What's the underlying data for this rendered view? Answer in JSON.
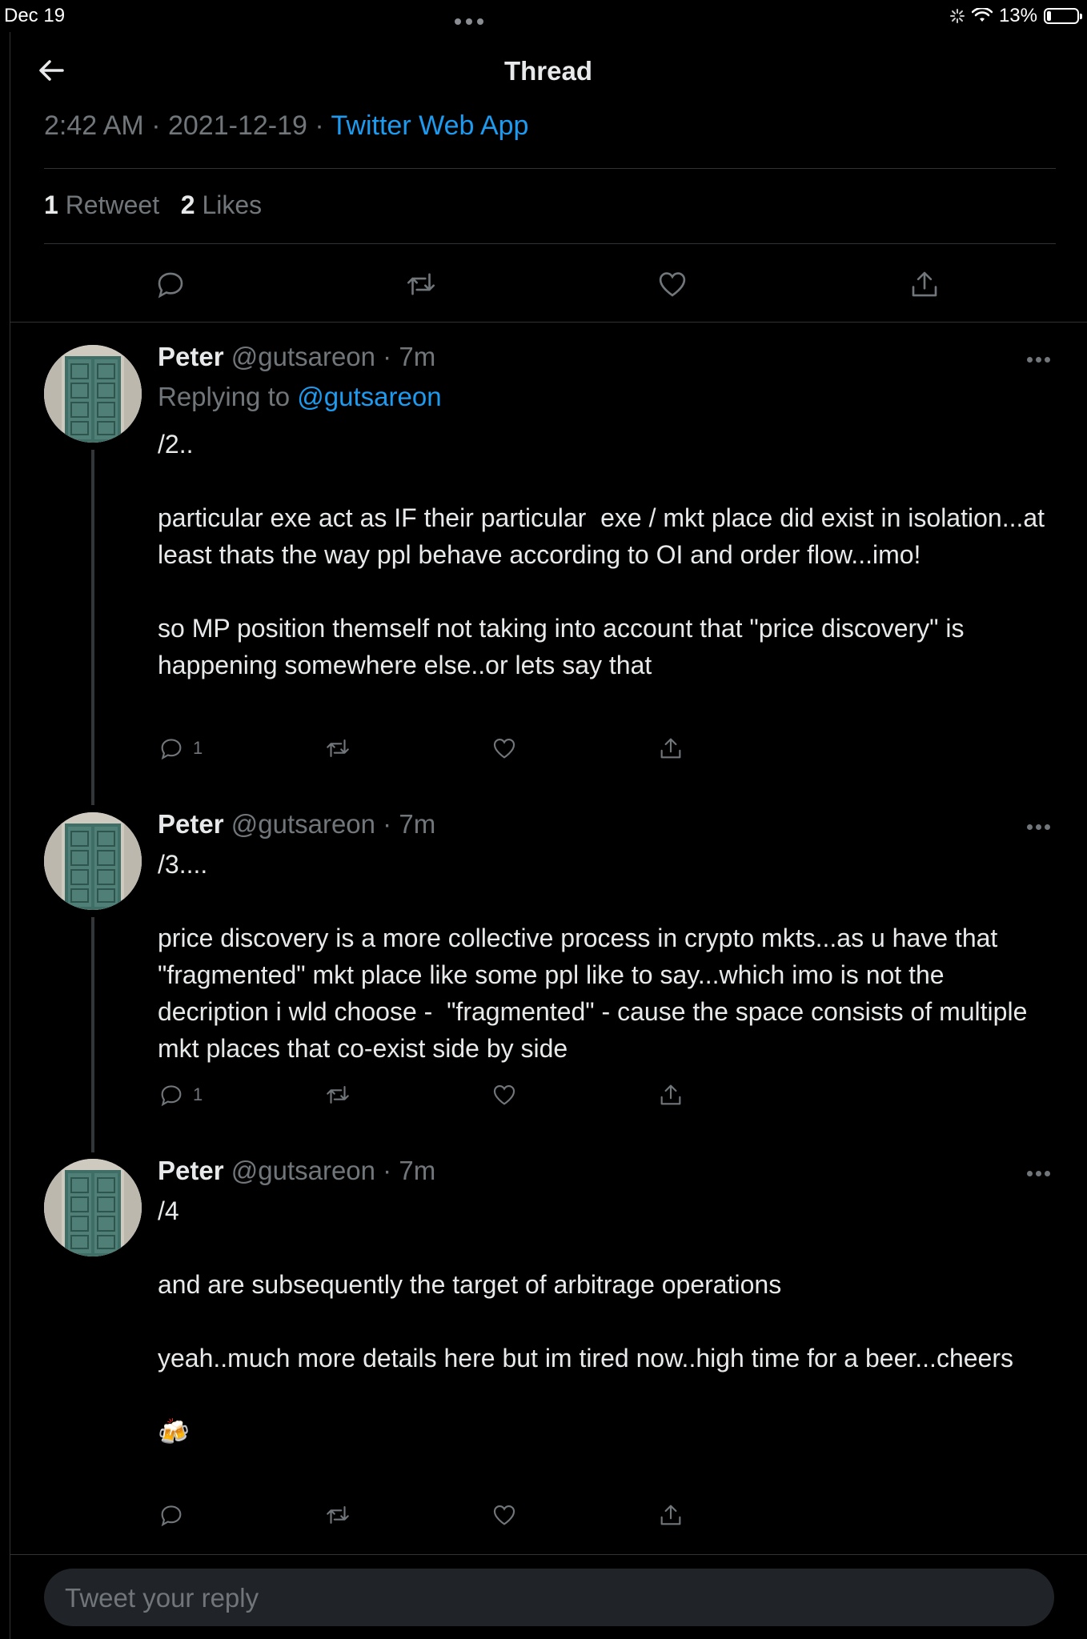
{
  "statusbar": {
    "date": "Dec 19",
    "battery": "13%",
    "battery_level": 0.13
  },
  "header": {
    "title": "Thread"
  },
  "main_tweet": {
    "time": "2:42 AM",
    "separator": "·",
    "date": "2021-12-19",
    "source": "Twitter Web App",
    "retweets": "1",
    "retweets_label": "Retweet",
    "likes": "2",
    "likes_label": "Likes"
  },
  "tweets": [
    {
      "name": "Peter",
      "handle": "@gutsareon",
      "time": "7m",
      "replying_label": "Replying to",
      "replying_to": "@gutsareon",
      "body": "/2..\n\nparticular exe act as IF their particular  exe / mkt place did exist in isolation...at least thats the way ppl behave according to OI and order flow...imo!\n\nso MP position themself not taking into account that \"price discovery\" is happening somewhere else..or lets say that",
      "replies": "1"
    },
    {
      "name": "Peter",
      "handle": "@gutsareon",
      "time": "7m",
      "body": "/3....\n\nprice discovery is a more collective process in crypto mkts...as u have that \"fragmented\" mkt place like some ppl like to say...which imo is not the decription i wld choose -  \"fragmented\" - cause the space consists of multiple mkt places that co-exist side by side",
      "replies": "1"
    },
    {
      "name": "Peter",
      "handle": "@gutsareon",
      "time": "7m",
      "body": "/4\n\nand are subsequently the target of arbitrage operations\n\nyeah..much more details here but im tired now..high time for a beer...cheers\n\n🍻",
      "replies": ""
    }
  ],
  "reply_box": {
    "placeholder": "Tweet your reply"
  },
  "icons": {
    "back": "back-arrow-icon",
    "reply": "reply-icon",
    "retweet": "retweet-icon",
    "like": "heart-icon",
    "share": "share-icon",
    "more": "more-icon"
  },
  "colors": {
    "background": "#000000",
    "accent": "#1d9bf0",
    "muted": "#71767b",
    "text": "#e7e9ea"
  }
}
